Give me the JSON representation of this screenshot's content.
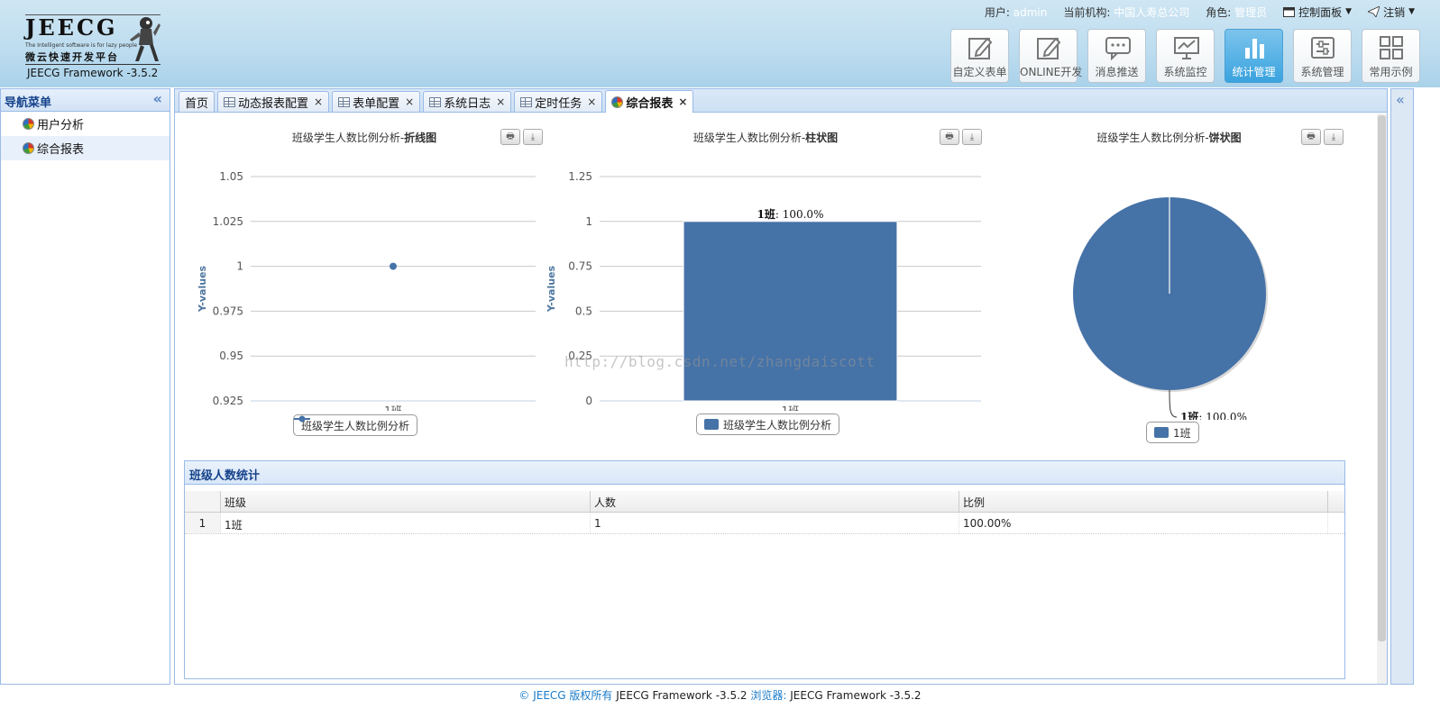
{
  "header": {
    "logo_word": "JEECG",
    "logo_tagline": "The Intelligent software is for lazy people",
    "logo_cn": "微云快速开发平台",
    "framework": "JEECG Framework -3.5.2",
    "user_label": "用户:",
    "user_value": "admin",
    "org_label": "当前机构:",
    "org_value": "中国人寿总公司",
    "role_label": "角色:",
    "role_value": "管理员",
    "control_panel": "控制面板",
    "logout": "注销",
    "modules": [
      {
        "label": "自定义表单",
        "icon": "edit-form-icon"
      },
      {
        "label": "ONLINE开发",
        "icon": "online-dev-icon"
      },
      {
        "label": "消息推送",
        "icon": "message-icon"
      },
      {
        "label": "系统监控",
        "icon": "monitor-icon"
      },
      {
        "label": "统计管理",
        "icon": "bar-stats-icon"
      },
      {
        "label": "系统管理",
        "icon": "settings-icon"
      },
      {
        "label": "常用示例",
        "icon": "grid-examples-icon"
      }
    ]
  },
  "sidebar": {
    "title": "导航菜单",
    "items": [
      {
        "label": "用户分析"
      },
      {
        "label": "综合报表"
      }
    ]
  },
  "tabs": [
    {
      "label": "首页"
    },
    {
      "label": "动态报表配置"
    },
    {
      "label": "表单配置"
    },
    {
      "label": "系统日志"
    },
    {
      "label": "定时任务"
    },
    {
      "label": "综合报表"
    }
  ],
  "charts": {
    "line": {
      "title_prefix": "班级学生人数比例分析-",
      "title_bold": "折线图",
      "ylabel": "Y-values",
      "legend": "班级学生人数比例分析"
    },
    "bar": {
      "title_prefix": "班级学生人数比例分析-",
      "title_bold": "柱状图",
      "ylabel": "Y-values",
      "legend": "班级学生人数比例分析",
      "data_label_bold": "1班",
      "data_label_rest": ": 100.0%"
    },
    "pie": {
      "title_prefix": "班级学生人数比例分析-",
      "title_bold": "饼状图",
      "legend": "1班",
      "data_label_bold": "1班",
      "data_label_rest": ": 100.0%"
    }
  },
  "chart_data": [
    {
      "type": "line",
      "categories": [
        "1班"
      ],
      "series": [
        {
          "name": "班级学生人数比例分析",
          "values": [
            1
          ]
        }
      ],
      "ylabel": "Y-values",
      "ylim": [
        0.925,
        1.05
      ],
      "yticks": [
        "1.05",
        "1.025",
        "1",
        "0.975",
        "0.95",
        "0.925"
      ],
      "grid": true,
      "legend": "bottom-center",
      "color": "#4572a7"
    },
    {
      "type": "bar",
      "categories": [
        "1班"
      ],
      "series": [
        {
          "name": "班级学生人数比例分析",
          "values": [
            1
          ]
        }
      ],
      "ylabel": "Y-values",
      "ylim": [
        0,
        1.25
      ],
      "yticks": [
        "1.25",
        "1",
        "0.75",
        "0.5",
        "0.25",
        "0"
      ],
      "grid": true,
      "legend": "bottom-center",
      "color": "#4572a7"
    },
    {
      "type": "pie",
      "slices": [
        {
          "name": "1班",
          "value": 100.0
        }
      ],
      "legend": "bottom-center",
      "color": "#4572a7"
    }
  ],
  "watermark": "http://blog.csdn.net/zhangdaiscott",
  "table": {
    "title": "班级人数统计",
    "columns": [
      "班级",
      "人数",
      "比例"
    ],
    "rows": [
      {
        "num": "1",
        "cells": [
          "1班",
          "1",
          "100.00%"
        ]
      }
    ]
  },
  "footer": {
    "copyright": "© JEECG 版权所有",
    "framework": "JEECG Framework -3.5.2",
    "browser_label": "浏览器:",
    "browser_value": "JEECG Framework -3.5.2"
  }
}
